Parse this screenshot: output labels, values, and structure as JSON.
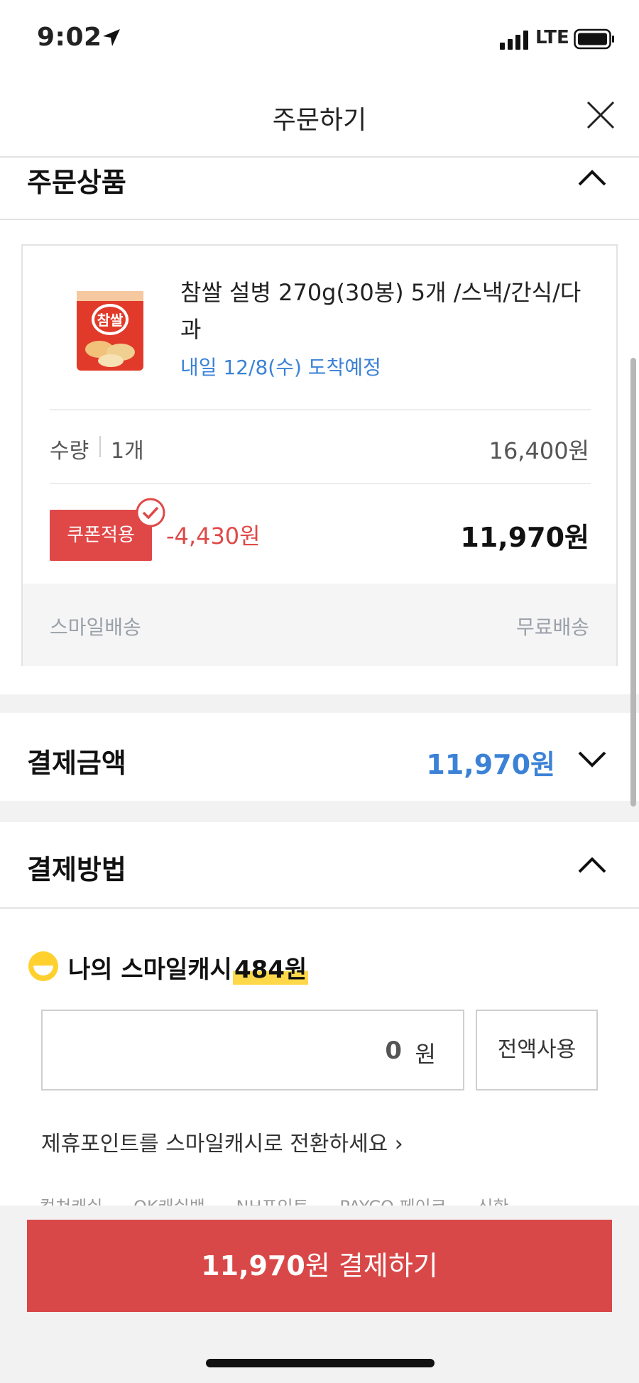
{
  "status_bar": {
    "time": "9:02",
    "carrier": "LTE"
  },
  "header": {
    "title": "주문하기"
  },
  "order_items": {
    "section_title": "주문상품",
    "product": {
      "name": "참쌀 설병 270g(30봉) 5개 /스낵/간식/다과",
      "delivery_eta": "내일 12/8(수) 도착예정",
      "thumbnail_text": "참쌀",
      "quantity_label": "수량",
      "quantity_value": "1개",
      "price": "16,400원",
      "coupon_label": "쿠폰적용",
      "discount": "-4,430원",
      "final_price": "11,970원",
      "shipping_method": "스마일배송",
      "shipping_fee": "무료배송"
    }
  },
  "payment_amount": {
    "title": "결제금액",
    "amount": "11,970원"
  },
  "payment_method": {
    "title": "결제방법",
    "smile_cash": {
      "label": "나의 스마일캐시",
      "balance": "484원"
    },
    "cash_input": {
      "value": "0",
      "unit": "원"
    },
    "use_all_label": "전액사용",
    "convert_link": "제휴포인트를 스마일캐시로 전환하세요 ›",
    "partners": [
      "컬쳐캐쉬",
      "OK캐쉬백",
      "NH포인트",
      "PAYCO 페이코",
      "신한"
    ]
  },
  "pay_button": {
    "amount": "11,970",
    "label": "원 결제하기"
  },
  "colors": {
    "accent_red": "#d94848",
    "accent_blue": "#3b82d6",
    "highlight_yellow": "#ffd84a"
  }
}
